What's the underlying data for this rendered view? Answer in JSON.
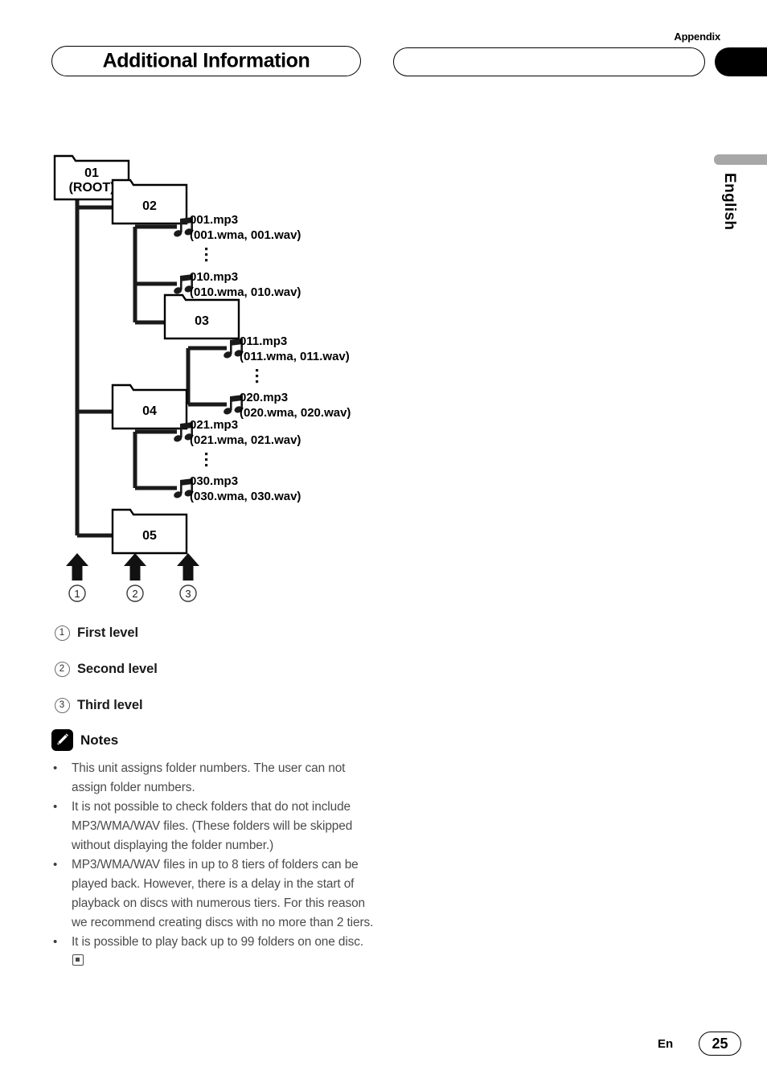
{
  "header": {
    "appendix_label": "Appendix",
    "title": "Additional Information",
    "blank_pill": ""
  },
  "sidebar": {
    "language_tab": "English"
  },
  "diagram": {
    "folders": [
      {
        "id": "root",
        "label_line1": "01",
        "label_line2": "(ROOT)"
      },
      {
        "id": "f02",
        "label_line1": "02",
        "label_line2": ""
      },
      {
        "id": "f03",
        "label_line1": "03",
        "label_line2": ""
      },
      {
        "id": "f04",
        "label_line1": "04",
        "label_line2": ""
      },
      {
        "id": "f05",
        "label_line1": "05",
        "label_line2": ""
      }
    ],
    "files": [
      {
        "id": "file001",
        "primary": "001.mp3",
        "alternates": "(001.wma, 001.wav)"
      },
      {
        "id": "file010",
        "primary": "010.mp3",
        "alternates": "(010.wma, 010.wav)"
      },
      {
        "id": "file011",
        "primary": "011.mp3",
        "alternates": "(011.wma, 011.wav)"
      },
      {
        "id": "file020",
        "primary": "020.mp3",
        "alternates": "(020.wma, 020.wav)"
      },
      {
        "id": "file021",
        "primary": "021.mp3",
        "alternates": "(021.wma, 021.wav)"
      },
      {
        "id": "file030",
        "primary": "030.mp3",
        "alternates": "(030.wma, 030.wav)"
      }
    ],
    "ellipses_count": 3,
    "level_markers": [
      "1",
      "2",
      "3"
    ]
  },
  "legend": {
    "items": [
      {
        "num": "1",
        "label": "First level"
      },
      {
        "num": "2",
        "label": "Second level"
      },
      {
        "num": "3",
        "label": "Third level"
      }
    ]
  },
  "notes": {
    "icon": "pencil-icon",
    "title": "Notes",
    "bullet": "•",
    "items": [
      "This unit assigns folder numbers. The user can not assign folder numbers.",
      "It is not possible to check folders that do not include MP3/WMA/WAV files. (These folders will be skipped without displaying the folder number.)",
      "MP3/WMA/WAV files in up to 8 tiers of folders can be played back. However, there is a delay in the start of playback on discs with numerous tiers. For this reason we recommend creating discs with no more than 2 tiers.",
      "It is possible to play back up to 99 folders on one disc."
    ],
    "last_item_has_end_mark": true
  },
  "footer": {
    "language_code": "En",
    "page_number": "25"
  },
  "colors": {
    "ink": "#231f20",
    "black": "#000000",
    "body_text": "#4b4b4b",
    "lang_tab_gray": "#a7a7a7"
  }
}
